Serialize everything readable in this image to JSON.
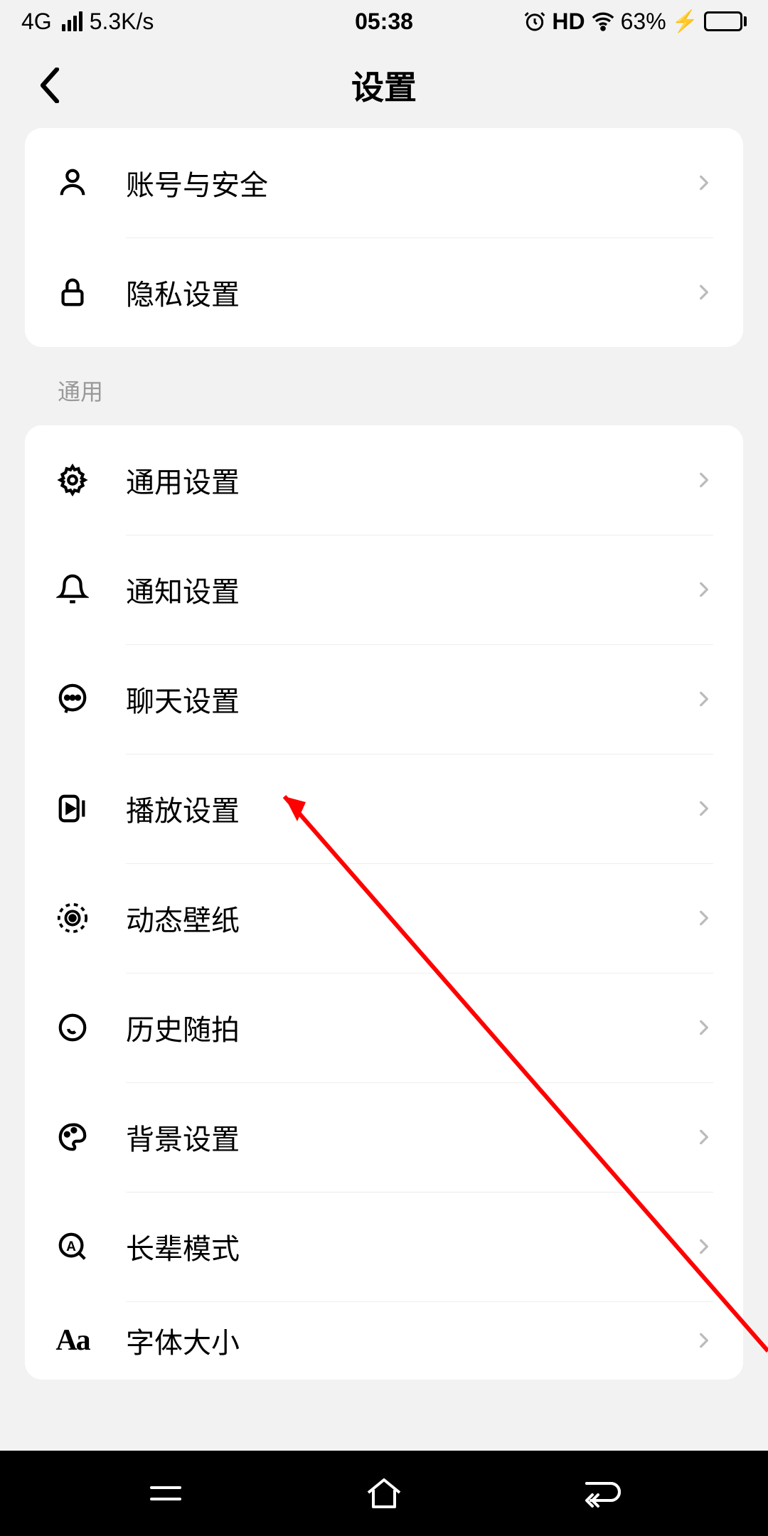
{
  "status": {
    "network": "4G",
    "speed": "5.3K/s",
    "time": "05:38",
    "hd": "HD",
    "battery_pct": "63%"
  },
  "header": {
    "title": "设置"
  },
  "group1": [
    {
      "label": "账号与安全",
      "icon": "user"
    },
    {
      "label": "隐私设置",
      "icon": "lock"
    }
  ],
  "section_general_title": "通用",
  "group2": [
    {
      "label": "通用设置",
      "icon": "gear"
    },
    {
      "label": "通知设置",
      "icon": "bell"
    },
    {
      "label": "聊天设置",
      "icon": "chat"
    },
    {
      "label": "播放设置",
      "icon": "play"
    },
    {
      "label": "动态壁纸",
      "icon": "live"
    },
    {
      "label": "历史随拍",
      "icon": "clock"
    },
    {
      "label": "背景设置",
      "icon": "palette"
    },
    {
      "label": "长辈模式",
      "icon": "amag"
    },
    {
      "label": "字体大小",
      "icon": "aa"
    }
  ]
}
